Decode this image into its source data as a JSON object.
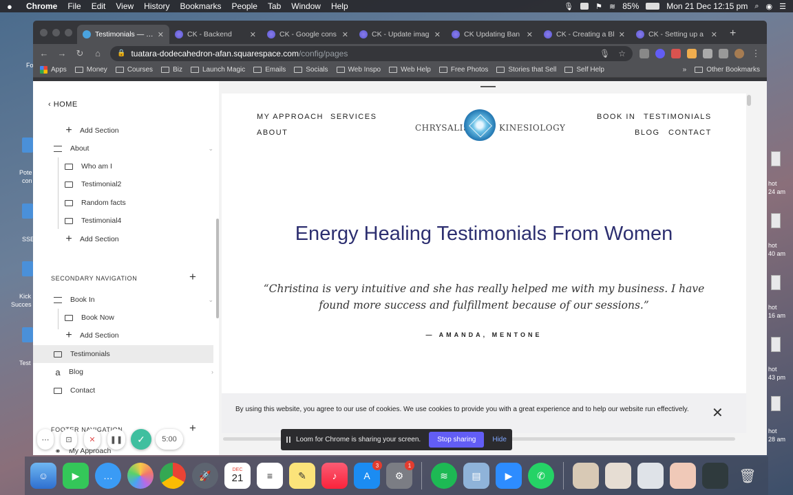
{
  "menubar": {
    "app": "Chrome",
    "items": [
      "File",
      "Edit",
      "View",
      "History",
      "Bookmarks",
      "People",
      "Tab",
      "Window",
      "Help"
    ],
    "battery": "85%",
    "clock": "Mon 21 Dec  12:15 pm"
  },
  "desktop": {
    "left_labels": [
      "Fo",
      "Pote",
      "con",
      "SSE",
      "Kick",
      "Succes",
      "Test"
    ],
    "right_labels": [
      "hot",
      "24 am",
      "hot",
      "40 am",
      "hot",
      "16 am",
      "hot",
      "43 pm",
      "hot",
      "28 am"
    ]
  },
  "tabs": [
    {
      "title": "Testimonials — CK",
      "active": true
    },
    {
      "title": "CK - Backend",
      "active": false
    },
    {
      "title": "CK - Google cons",
      "active": false
    },
    {
      "title": "CK - Update imag",
      "active": false
    },
    {
      "title": "CK Updating Ban",
      "active": false
    },
    {
      "title": "CK - Creating a Bl",
      "active": false
    },
    {
      "title": "CK - Setting up a",
      "active": false
    }
  ],
  "omnibox": {
    "host": "tuatara-dodecahedron-afan.squarespace.com",
    "path": "/config/pages"
  },
  "bookmarks": [
    "Apps",
    "Money",
    "Courses",
    "Biz",
    "Launch Magic",
    "Emails",
    "Socials",
    "Web Inspo",
    "Web Help",
    "Free Photos",
    "Stories that Sell",
    "Self Help"
  ],
  "bookmarks_overflow": "»",
  "bookmarks_other": "Other Bookmarks",
  "sidebar": {
    "home": "HOME",
    "add_section_top": "Add Section",
    "about": "About",
    "about_children": [
      "Who am I",
      "Testimonial2",
      "Random facts",
      "Testimonial4"
    ],
    "add_section": "Add Section",
    "secondary_nav": "SECONDARY NAVIGATION",
    "book_in": "Book In",
    "book_now": "Book Now",
    "add_section_2": "Add Section",
    "testimonials": "Testimonials",
    "blog": "Blog",
    "contact": "Contact",
    "footer_nav": "FOOTER NAVIGATION",
    "my_approach": "My Approach"
  },
  "site": {
    "nav_left": [
      "MY APPROACH",
      "SERVICES",
      "ABOUT"
    ],
    "nav_right": [
      "BOOK IN",
      "TESTIMONIALS",
      "BLOG",
      "CONTACT"
    ],
    "logo_left": "CHRYSALIS",
    "logo_right": "KINESIOLOGY",
    "headline": "Energy Healing Testimonials From Women",
    "quote": "“Christina is very intuitive and she has really helped me with my business. I have found more success and fulfillment because of our sessions.”",
    "attribution": "— AMANDA, MENTONE"
  },
  "cookie": {
    "text": "By using this website, you agree to our use of cookies. We use cookies to provide you with a great experience and to help our website run effectively.",
    "close": "✕"
  },
  "loom": {
    "message": "Loom for Chrome is sharing your screen.",
    "stop": "Stop sharing",
    "hide": "Hide",
    "timer": "5:00"
  },
  "dock": {
    "badges": {
      "appstore": "3",
      "prefs": "1"
    },
    "calendar_day": "21",
    "calendar_month": "DEC"
  }
}
